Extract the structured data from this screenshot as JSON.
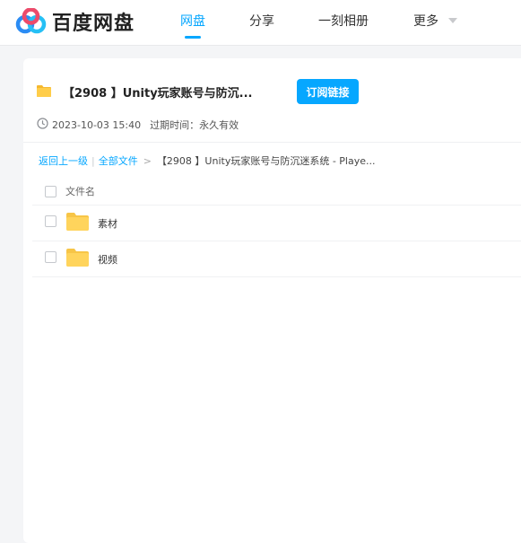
{
  "app": {
    "logo_text": "百度网盘"
  },
  "nav": {
    "items": [
      "网盘",
      "分享",
      "一刻相册",
      "更多"
    ],
    "active": "网盘"
  },
  "share": {
    "title": "【2908 】Unity玩家账号与防沉...",
    "subscribe_label": "订阅链接",
    "date": "2023-10-03 15:40",
    "expiry_label": "过期时间：",
    "expiry_value": "永久有效"
  },
  "breadcrumb": {
    "back": "返回上一级",
    "all": "全部文件",
    "separator": ">",
    "current": "【2908 】Unity玩家账号与防沉迷系统 - Playe..."
  },
  "list": {
    "header": "文件名",
    "items": [
      {
        "name": "素材",
        "icon": "folder-icon"
      },
      {
        "name": "视频",
        "icon": "folder-icon"
      }
    ]
  },
  "colors": {
    "accent": "#06a7ff",
    "folder": "#ffd45c"
  }
}
